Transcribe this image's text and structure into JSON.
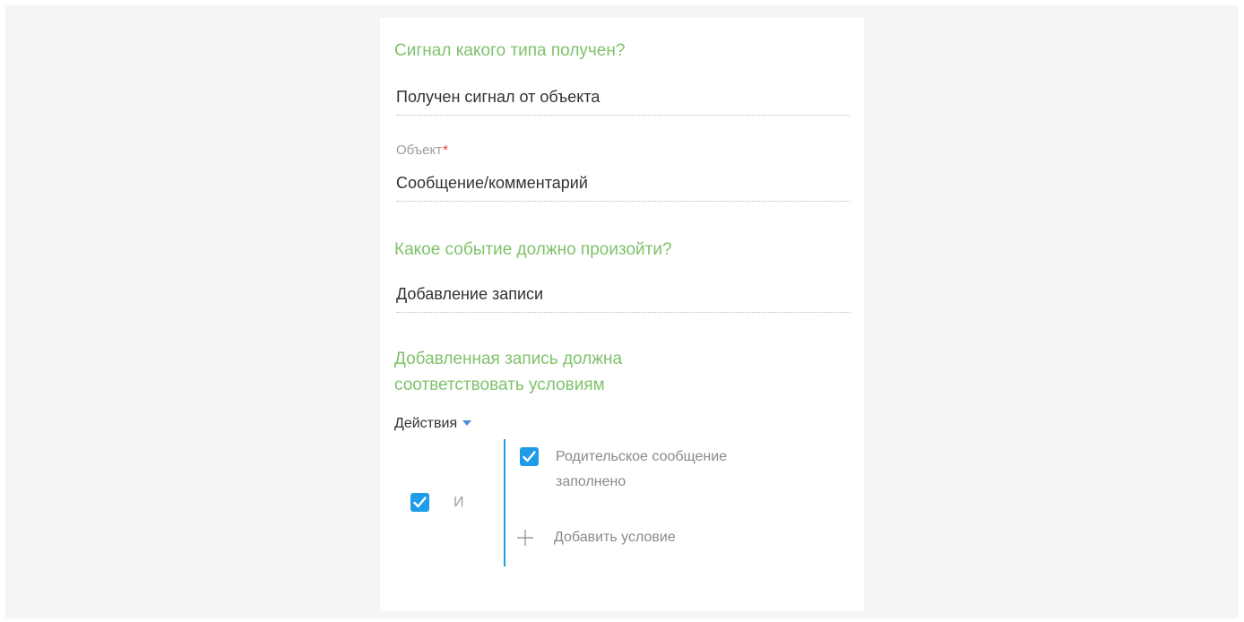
{
  "signal_section": {
    "heading": "Сигнал какого типа получен?",
    "signal_type_value": "Получен сигнал от объекта"
  },
  "object_field": {
    "label": "Объект",
    "required_mark": "*",
    "value": "Сообщение/комментарий"
  },
  "event_section": {
    "heading": "Какое событие должно произойти?",
    "event_value": "Добавление записи"
  },
  "conditions_section": {
    "heading_line1": "Добавленная запись должна",
    "heading_line2": "соответствовать условиям",
    "actions_label": "Действия",
    "group_operator": "И",
    "group_checked": true,
    "condition": {
      "text_line1": "Родительское сообщение",
      "text_line2": "заполнено",
      "checked": true
    },
    "add_condition_label": "Добавить условие"
  },
  "colors": {
    "heading_green": "#7fc26b",
    "accent_blue": "#1e9be9",
    "required_red": "#e53935"
  },
  "icons": {
    "actions_dropdown": "caret-down-icon",
    "checkbox": "checkmark-icon",
    "add_condition": "plus-icon"
  }
}
